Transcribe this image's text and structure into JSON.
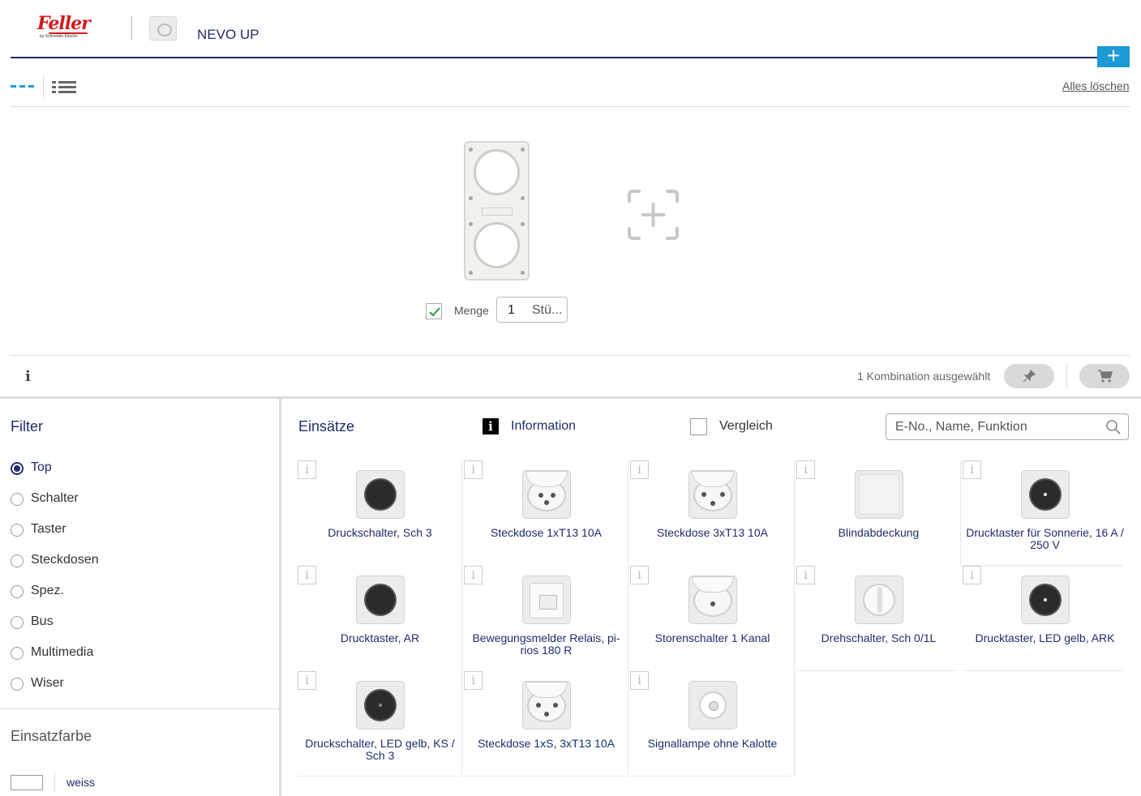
{
  "header": {
    "logo_text": "Feller",
    "logo_sub": "by Schneider Electric",
    "product_title": "NEVO UP",
    "add_label": "+"
  },
  "toolbar": {
    "clear_all": "Alles löschen"
  },
  "configurator": {
    "quantity_label": "Menge",
    "quantity_value": "1",
    "quantity_unit": "Stü...",
    "quantity_checked": true,
    "info_label": "i",
    "selection_status": "1 Kombination ausgewählt"
  },
  "filter": {
    "title": "Filter",
    "options": [
      {
        "label": "Top",
        "selected": true
      },
      {
        "label": "Schalter",
        "selected": false
      },
      {
        "label": "Taster",
        "selected": false
      },
      {
        "label": "Steckdosen",
        "selected": false
      },
      {
        "label": "Spez.",
        "selected": false
      },
      {
        "label": "Bus",
        "selected": false
      },
      {
        "label": "Multimedia",
        "selected": false
      },
      {
        "label": "Wiser",
        "selected": false
      }
    ],
    "color_title": "Einsatzfarbe",
    "color_option": "weiss"
  },
  "inserts": {
    "title": "Einsätze",
    "info_icon": "i",
    "info_label": "Information",
    "compare_label": "Vergleich",
    "search_placeholder": "E-No., Name, Funktion",
    "card_info": "i",
    "products": [
      {
        "name": "Druckschalter, Sch 3",
        "icon": "black-button"
      },
      {
        "name": "Steckdose 1xT13 10A",
        "icon": "socket"
      },
      {
        "name": "Steckdose 3xT13 10A",
        "icon": "socket"
      },
      {
        "name": "Blindabdeckung",
        "icon": "blank"
      },
      {
        "name": "Drucktaster für Sonnerie, 16 A / 250 V",
        "icon": "black-button-dot"
      },
      {
        "name": "Drucktaster, AR",
        "icon": "black-button"
      },
      {
        "name": "Bewegungsmelder Relais, pi-rios 180 R",
        "icon": "motion"
      },
      {
        "name": "Storenschalter 1 Kanal",
        "icon": "socket"
      },
      {
        "name": "Drehschalter, Sch 0/1L",
        "icon": "knob"
      },
      {
        "name": "Drucktaster, LED gelb, ARK",
        "icon": "black-button-dot"
      },
      {
        "name": "Druckschalter, LED gelb, KS / Sch 3",
        "icon": "black-button-dot"
      },
      {
        "name": "Steckdose 1xS, 3xT13 10A",
        "icon": "socket"
      },
      {
        "name": "Signallampe ohne Kalotte",
        "icon": "lamp"
      }
    ]
  }
}
